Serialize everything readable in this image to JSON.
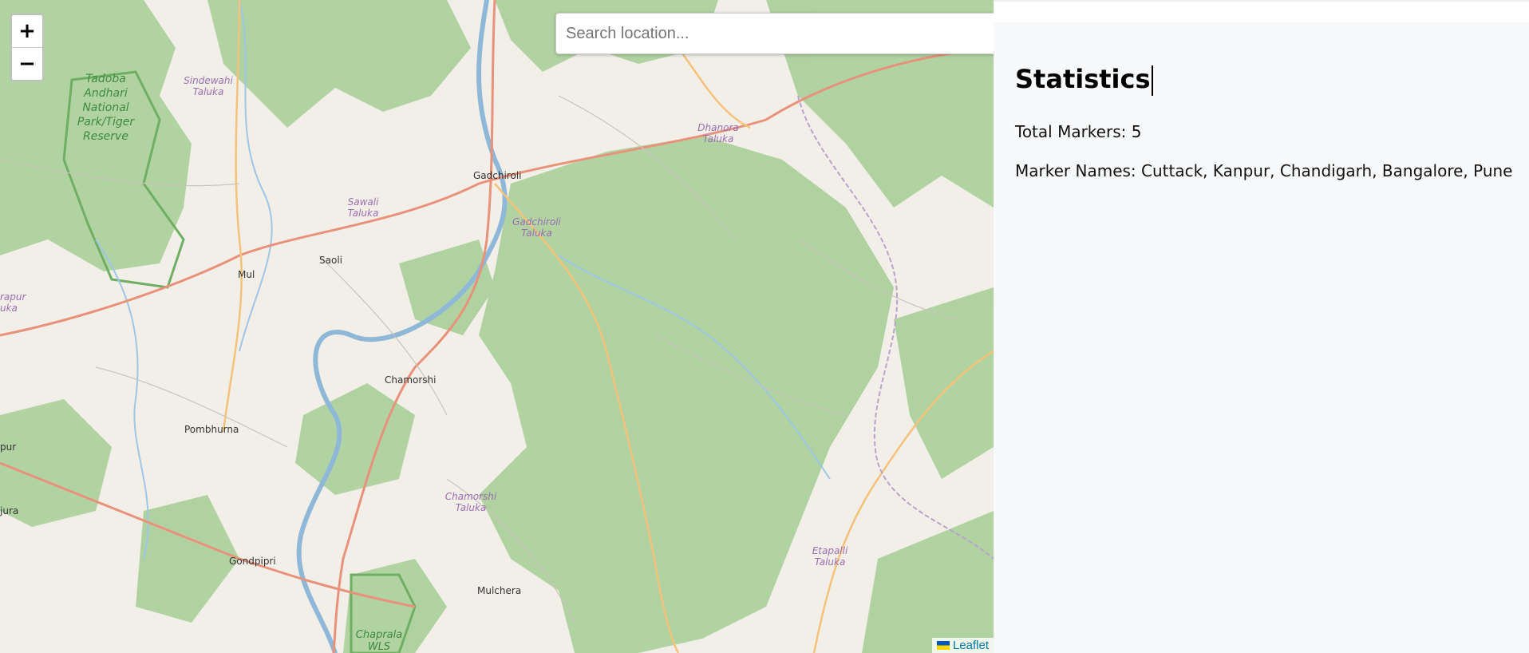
{
  "map": {
    "search_placeholder": "Search location...",
    "zoom_in": "+",
    "zoom_out": "−",
    "attribution": "Leaflet",
    "labels": {
      "gadchiroli": "Gadchiroli",
      "saoli": "Saoli",
      "mul": "Mul",
      "chamorshi": "Chamorshi",
      "pombhurna": "Pombhurna",
      "gondpipri": "Gondpipri",
      "mulchera": "Mulchera",
      "sindewahi": "Sindewahi Taluka",
      "sawali": "Sawali Taluka",
      "gadchiroli_taluka": "Gadchiroli Taluka",
      "dhanora": "Dhanora Taluka",
      "chamorshi_taluka": "Chamorshi Taluka",
      "etapalli": "Etapalli Taluka",
      "tadoba": "Tadoba Andhari National Park/Tiger Reserve",
      "chaprala": "Chaprala WLS",
      "rapur": "rapur uka",
      "pur": "pur",
      "jura": "jura"
    }
  },
  "stats": {
    "title": "Statistics",
    "total_markers": "Total Markers: 5",
    "marker_names": "Marker Names: Cuttack, Kanpur, Chandigarh, Bangalore, Pune"
  }
}
